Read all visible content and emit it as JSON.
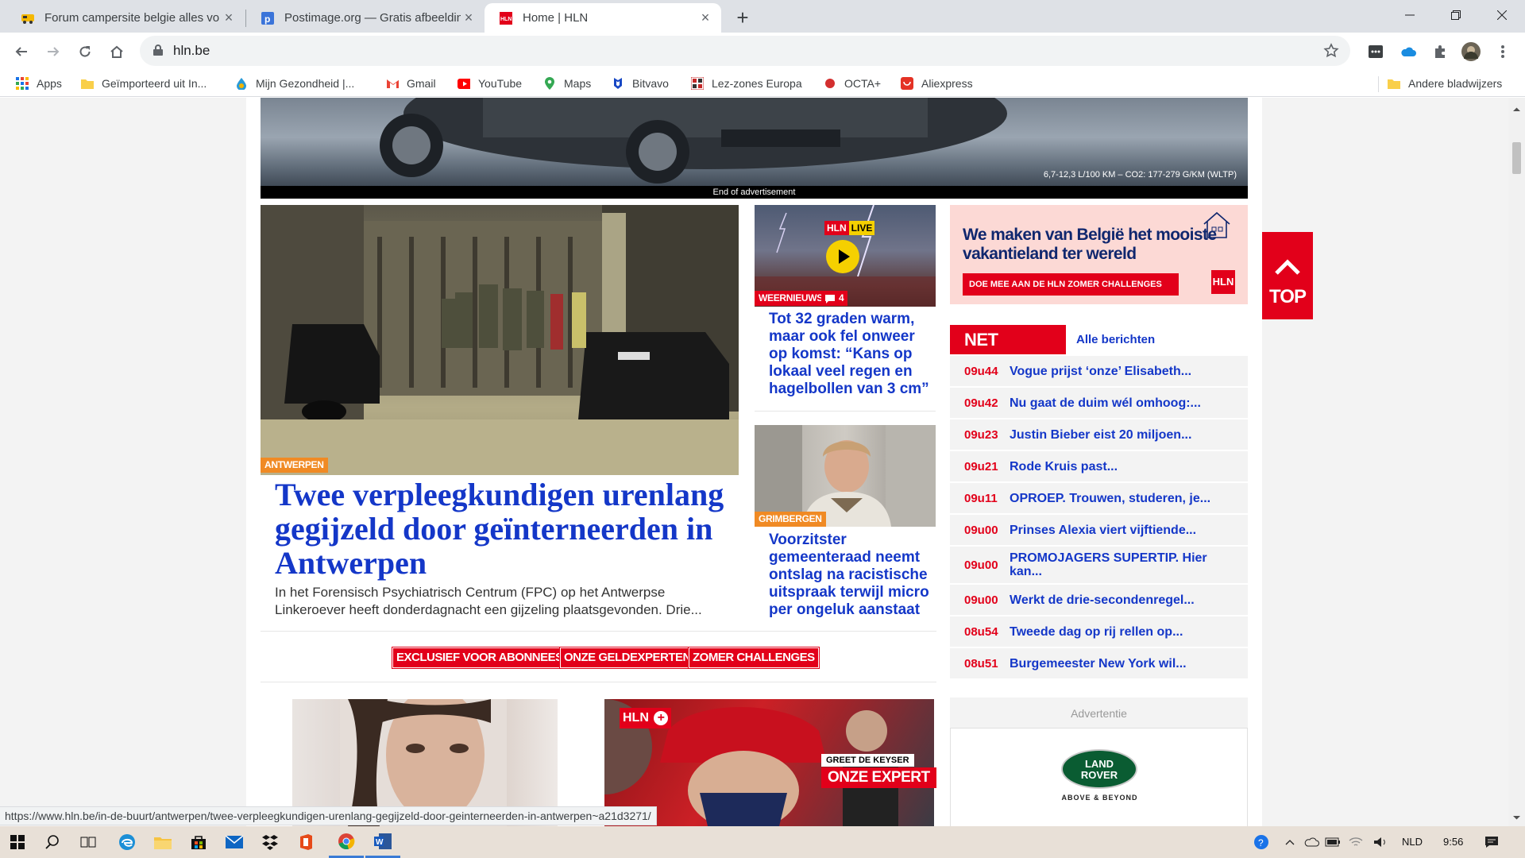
{
  "browser": {
    "tabs": [
      {
        "title": "Forum campersite belgie alles vo",
        "active": false
      },
      {
        "title": "Postimage.org — Gratis afbeeldin",
        "active": false
      },
      {
        "title": "Home | HLN",
        "active": true
      }
    ],
    "new_tab": "+",
    "url": "hln.be",
    "bookmarks": [
      {
        "label": "Apps",
        "icon": "apps-grid-icon"
      },
      {
        "label": "Geïmporteerd uit In...",
        "icon": "folder-icon"
      },
      {
        "label": "Mijn Gezondheid |...",
        "icon": "health-icon"
      },
      {
        "label": "Gmail",
        "icon": "gmail-icon"
      },
      {
        "label": "YouTube",
        "icon": "youtube-icon"
      },
      {
        "label": "Maps",
        "icon": "maps-icon"
      },
      {
        "label": "Bitvavo",
        "icon": "bitvavo-icon"
      },
      {
        "label": "Lez-zones Europa",
        "icon": "lez-icon"
      },
      {
        "label": "OCTA+",
        "icon": "octa-icon"
      },
      {
        "label": "Aliexpress",
        "icon": "aliexpress-icon"
      }
    ],
    "other_bookmarks": "Andere bladwijzers",
    "status_url": "https://www.hln.be/in-de-buurt/antwerpen/twee-verpleegkundigen-urenlang-gegijzeld-door-geinterneerden-in-antwerpen~a21d3271/"
  },
  "ad": {
    "wltp": "6,7-12,3 L/100 KM – CO2: 177-279 G/KM (WLTP)",
    "end_label": "End of advertisement"
  },
  "main_article": {
    "tag": "ANTWERPEN",
    "title": "Twee verpleegkundigen urenlang gegijzeld door geïnterneerden in Antwerpen",
    "lead": "In het Forensisch Psychiatrisch Centrum (FPC) op het Antwerpse Linkeroever heeft donderdagnacht een gijzeling plaatsgevonden. Drie..."
  },
  "side_articles": [
    {
      "tag": "WEERNIEUWS",
      "live": "LIVE",
      "live_brand": "HLN",
      "comments": "4",
      "title": "Tot 32 graden warm, maar ook fel onweer op komst: “Kans op lokaal veel regen en hagelbollen van 3 cm”"
    },
    {
      "tag": "GRIMBERGEN",
      "title": "Voorzitster gemeenteraad neemt ontslag na racistische uitspraak terwijl micro per ongeluk aanstaat"
    }
  ],
  "pills": [
    "EXCLUSIEF VOOR ABONNEES",
    "ONZE GELDEXPERTEN",
    "ZOMER CHALLENGES"
  ],
  "promo": {
    "text": "We maken van België het mooiste vakantieland ter wereld",
    "cta": "DOE MEE AAN DE HLN ZOMER CHALLENGES",
    "logo": "HLN"
  },
  "net_binnen": {
    "heading": "NET BINNEN",
    "all_link": "Alle berichten",
    "items": [
      {
        "time": "09u44",
        "title": "Vogue prijst ‘onze’ Elisabeth..."
      },
      {
        "time": "09u42",
        "title": "Nu gaat de duim wél omhoog:..."
      },
      {
        "time": "09u23",
        "title": "Justin Bieber eist 20 miljoen..."
      },
      {
        "time": "09u21",
        "title": "Rode Kruis past..."
      },
      {
        "time": "09u11",
        "title": "OPROEP. Trouwen, studeren, je..."
      },
      {
        "time": "09u00",
        "title": "Prinses Alexia viert vijftiende..."
      },
      {
        "time": "09u00",
        "title": "PROMOJAGERS SUPERTIP. Hier kan..."
      },
      {
        "time": "09u00",
        "title": "Werkt de drie-secondenregel..."
      },
      {
        "time": "08u54",
        "title": "Tweede dag op rij rellen op..."
      },
      {
        "time": "08u51",
        "title": "Burgemeester New York wil..."
      }
    ]
  },
  "advert": {
    "label": "Advertentie",
    "brand_line1": "LAND",
    "brand_line2": "ROVER",
    "slogan": "ABOVE & BEYOND"
  },
  "top_button": "TOP",
  "bottom_cards": {
    "hln_plus": "HLN",
    "expert_name": "GREET DE KEYSER",
    "expert_label": "ONZE EXPERT"
  },
  "taskbar": {
    "language": "NLD",
    "time": "9:56"
  }
}
